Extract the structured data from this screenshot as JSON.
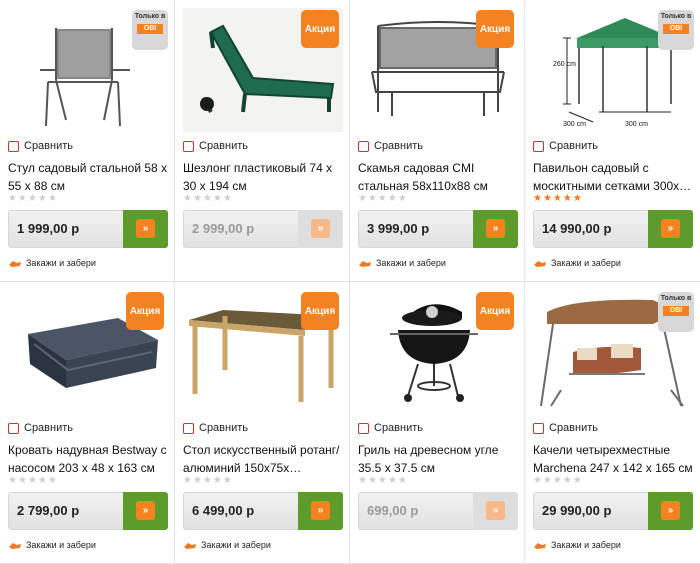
{
  "labels": {
    "compare": "Сравнить",
    "pickup": "Закажи и забери",
    "promo_badge": "Акция",
    "only_in": "Только в",
    "obi": "OBI"
  },
  "products": [
    {
      "name": "Стул садовый стальной 58 x 55 x 88 см",
      "price": "1 999,00 р",
      "rating": 0,
      "badge": "only_obi",
      "available": true
    },
    {
      "name": "Шезлонг пластиковый 74 x 30 x 194 см",
      "price": "2 999,00 р",
      "rating": 0,
      "badge": "akciya",
      "available": false
    },
    {
      "name": "Скамья садовая CMI стальная 58x110x88 см",
      "price": "3 999,00 р",
      "rating": 0,
      "badge": "akciya",
      "available": true
    },
    {
      "name": "Павильон садовый с москитными сетками 300x…",
      "price": "14 990,00 р",
      "rating": 5,
      "badge": "only_obi",
      "available": true,
      "image_labels": {
        "height": "260 cm",
        "width1": "300 cm",
        "width2": "300 cm"
      }
    },
    {
      "name": "Кровать надувная Bestway с насосом 203 x 48 x 163 см",
      "price": "2 799,00 р",
      "rating": 0,
      "badge": "akciya",
      "available": true
    },
    {
      "name": "Стол искусственный ротанг/алюминий 150x75x…",
      "price": "6 499,00 р",
      "rating": 0,
      "badge": "akciya",
      "available": true
    },
    {
      "name": "Гриль на древесном угле 35.5 x 37.5 см",
      "price": "699,00 р",
      "rating": 0,
      "badge": "akciya",
      "available": false
    },
    {
      "name": "Качели четырехместные Marchena 247 x 142 x 165 см",
      "price": "29 990,00 р",
      "rating": 0,
      "badge": "only_obi",
      "available": true
    }
  ]
}
